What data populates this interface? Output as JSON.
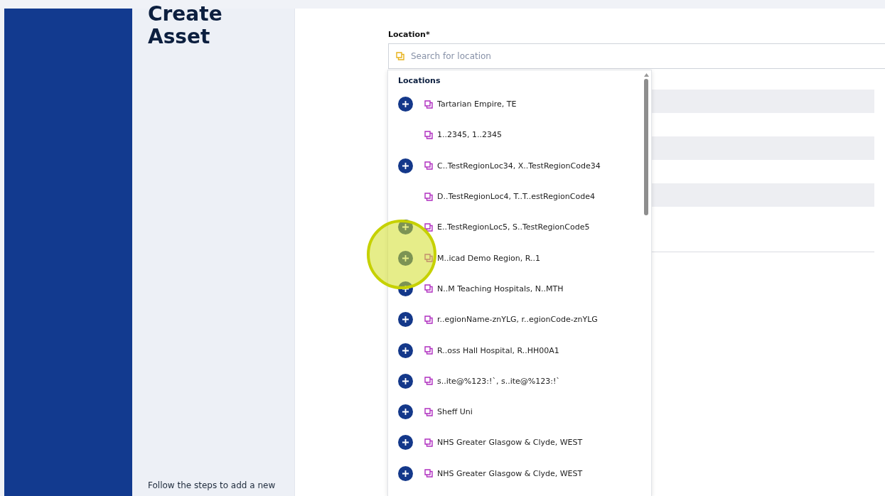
{
  "sidebar": {
    "title_lines": [
      "Create",
      "Asset"
    ],
    "description": "Follow the steps to add a new"
  },
  "location_field": {
    "label": "Location*",
    "placeholder": "Search for location"
  },
  "dropdown": {
    "heading": "Locations",
    "items": [
      {
        "label": "Tartarian Empire, TE",
        "can_add": true
      },
      {
        "label": "1..2345, 1..2345",
        "can_add": false
      },
      {
        "label": "C..TestRegionLoc34, X..TestRegionCode34",
        "can_add": true
      },
      {
        "label": "D..TestRegionLoc4, T..T..estRegionCode4",
        "can_add": false
      },
      {
        "label": "E..TestRegionLoc5, S..TestRegionCode5",
        "can_add": true
      },
      {
        "label": "M..icad Demo Region, R..1",
        "can_add": true
      },
      {
        "label": "N..M Teaching Hospitals, N..MTH",
        "can_add": true
      },
      {
        "label": "r..egionName-znYLG, r..egionCode-znYLG",
        "can_add": true
      },
      {
        "label": "R..oss Hall Hospital, R..HH00A1",
        "can_add": true
      },
      {
        "label": "s..ite@%123:!`, s..ite@%123:!`",
        "can_add": true
      },
      {
        "label": "Sheff Uni",
        "can_add": true
      },
      {
        "label": "NHS Greater Glasgow & Clyde, WEST",
        "can_add": true
      },
      {
        "label": "NHS Greater Glasgow & Clyde, WEST",
        "can_add": true
      }
    ]
  }
}
